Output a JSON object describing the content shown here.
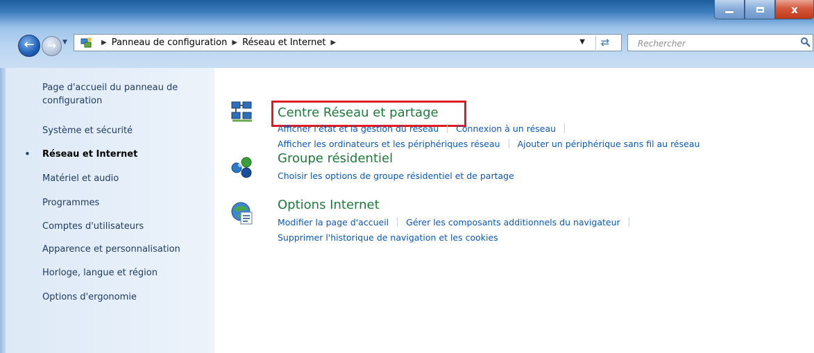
{
  "window": {
    "caption_buttons": {
      "minimize": "minimize",
      "maximize": "maximize",
      "close": "x"
    }
  },
  "navigation": {
    "breadcrumb": [
      "Panneau de configuration",
      "Réseau et Internet"
    ],
    "search_placeholder": "Rechercher"
  },
  "sidebar": {
    "items": [
      {
        "label": "Page d'accueil du panneau de",
        "label2": "configuration"
      },
      {
        "label": "Système et sécurité"
      },
      {
        "label": "Réseau et Internet",
        "active": true
      },
      {
        "label": "Matériel et audio"
      },
      {
        "label": "Programmes"
      },
      {
        "label": "Comptes d'utilisateurs"
      },
      {
        "label": "Apparence et personnalisation"
      },
      {
        "label": "Horloge, langue et région"
      },
      {
        "label": "Options d'ergonomie"
      }
    ]
  },
  "categories": [
    {
      "title": "Centre Réseau et partage",
      "icon": "network-center-icon",
      "links_row1": [
        "Afficher l'état et la gestion du réseau",
        "Connexion à un réseau"
      ],
      "links_row2": [
        "Afficher les ordinateurs et les périphériques réseau",
        "Ajouter un périphérique sans fil au réseau"
      ]
    },
    {
      "title": "Groupe résidentiel",
      "icon": "homegroup-icon",
      "links_row1": [
        "Choisir les options de groupe résidentiel et de partage"
      ]
    },
    {
      "title": "Options Internet",
      "icon": "internet-options-icon",
      "links_row1": [
        "Modifier la page d'accueil",
        "Gérer les composants additionnels du navigateur"
      ],
      "links_row2": [
        "Supprimer l'historique de navigation et les cookies"
      ]
    }
  ],
  "colors": {
    "highlight_box": "#e01b24",
    "category_title": "#1e7a3c",
    "link": "#0b57b5"
  }
}
